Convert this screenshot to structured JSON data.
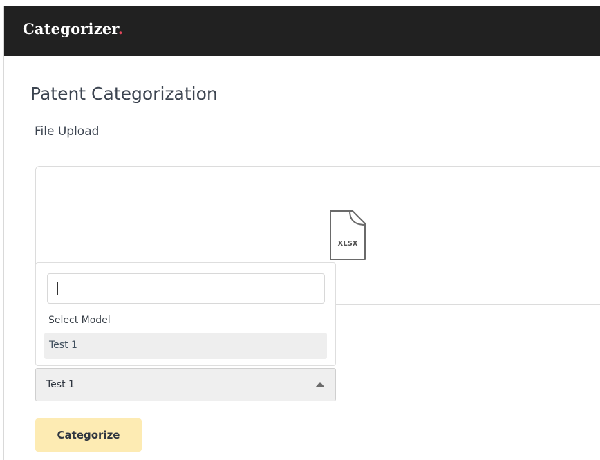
{
  "header": {
    "brand": "Categorizer",
    "brand_dot": ".",
    "brand_dot_color": "#e0475b",
    "background_color": "#212121"
  },
  "main": {
    "title": "Patent Categorization",
    "upload_label": "File Upload",
    "file_icon": "file-icon",
    "file_type_label": "XLSX"
  },
  "model_dropdown": {
    "search_value": "",
    "group_header": "Select Model",
    "options": [
      {
        "label": "Test 1"
      }
    ],
    "selected_value": "Test 1",
    "arrow_icon": "caret-up-icon"
  },
  "actions": {
    "categorize_label": "Categorize",
    "categorize_color": "#fdebb3"
  }
}
